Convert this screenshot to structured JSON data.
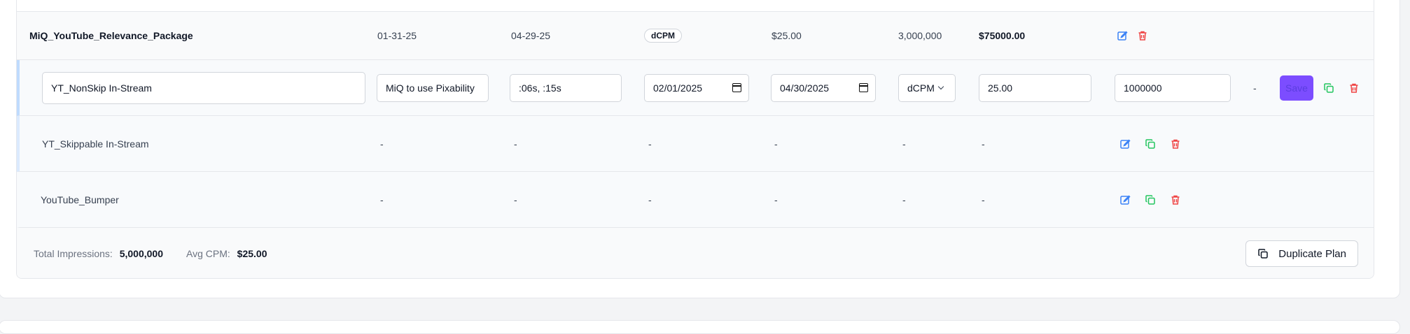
{
  "package": {
    "name": "MiQ_YouTube_Relevance_Package",
    "start_date": "01-31-25",
    "end_date": "04-29-25",
    "buy_type": "dCPM",
    "rate": "$25.00",
    "impressions": "3,000,000",
    "total": "$75000.00"
  },
  "edit_row": {
    "name": "YT_NonSkip In-Stream",
    "notes": "MiQ to use Pixability",
    "lengths": ":06s, :15s",
    "start_date": "02/01/2025",
    "end_date": "04/30/2025",
    "buy_type": "dCPM",
    "rate": "25.00",
    "impressions": "1000000",
    "total": "-",
    "save_label": "Save"
  },
  "sub_rows": [
    {
      "name": "YT_Skippable In-Stream",
      "c1": "-",
      "c2": "-",
      "c3": "-",
      "c4": "-",
      "c5": "-",
      "c6": "-"
    },
    {
      "name": "YouTube_Bumper",
      "c1": "-",
      "c2": "-",
      "c3": "-",
      "c4": "-",
      "c5": "-",
      "c6": "-"
    }
  ],
  "footer": {
    "total_impressions_label": "Total Impressions:",
    "total_impressions_value": "5,000,000",
    "avg_cpm_label": "Avg CPM:",
    "avg_cpm_value": "$25.00",
    "duplicate_label": "Duplicate Plan"
  },
  "colors": {
    "edit_icon": "#3b82f6",
    "copy_icon": "#22c55e",
    "delete_icon": "#ef4444",
    "save_button": "#7c4dff"
  },
  "icons": [
    "edit-icon",
    "copy-icon",
    "trash-icon"
  ]
}
